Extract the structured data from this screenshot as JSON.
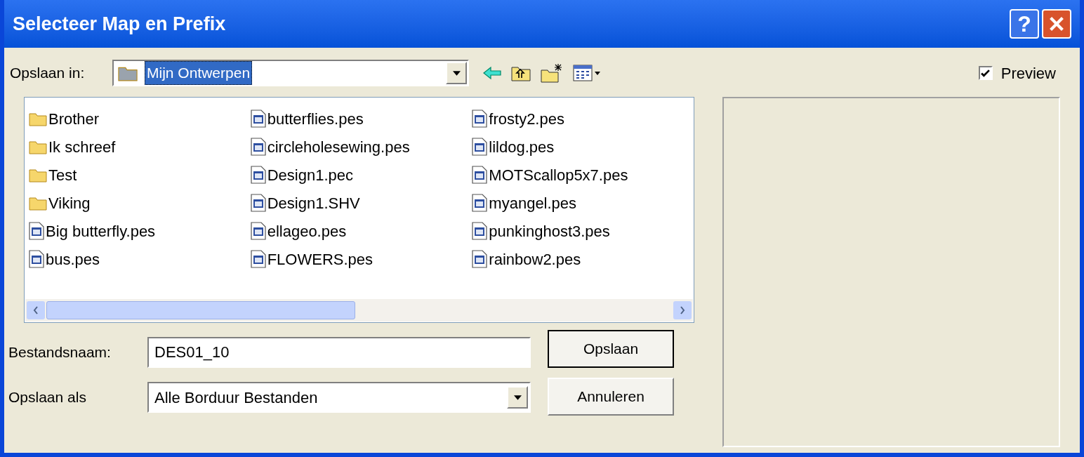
{
  "window": {
    "title": "Selecteer Map en Prefix"
  },
  "title_buttons": [
    {
      "kind": "help",
      "label": "?"
    },
    {
      "kind": "close"
    }
  ],
  "save_in": {
    "label": "Opslaan in:",
    "value": "Mijn Ontwerpen"
  },
  "preview": {
    "label": "Preview",
    "checked": true
  },
  "files": [
    {
      "name": "Brother",
      "kind": "folder"
    },
    {
      "name": "Ik schreef",
      "kind": "folder"
    },
    {
      "name": "Test",
      "kind": "folder"
    },
    {
      "name": "Viking",
      "kind": "folder"
    },
    {
      "name": "Big butterfly.pes",
      "kind": "file"
    },
    {
      "name": "bus.pes",
      "kind": "file"
    },
    {
      "name": "butterflies.pes",
      "kind": "file"
    },
    {
      "name": "circleholesewing.pes",
      "kind": "file"
    },
    {
      "name": "Design1.pec",
      "kind": "file"
    },
    {
      "name": "Design1.SHV",
      "kind": "file"
    },
    {
      "name": "ellageo.pes",
      "kind": "file"
    },
    {
      "name": "FLOWERS.pes",
      "kind": "file"
    },
    {
      "name": "frosty2.pes",
      "kind": "file"
    },
    {
      "name": "lildog.pes",
      "kind": "file"
    },
    {
      "name": "MOTScallop5x7.pes",
      "kind": "file"
    },
    {
      "name": "myangel.pes",
      "kind": "file"
    },
    {
      "name": "punkinghost3.pes",
      "kind": "file"
    },
    {
      "name": "rainbow2.pes",
      "kind": "file"
    }
  ],
  "filename": {
    "label": "Bestandsnaam:",
    "value": "DES01_10"
  },
  "filetype": {
    "label": "Opslaan als",
    "value": "Alle Borduur Bestanden"
  },
  "buttons": [
    {
      "label": "Opslaan",
      "default": true
    },
    {
      "label": "Annuleren",
      "default": false
    }
  ]
}
